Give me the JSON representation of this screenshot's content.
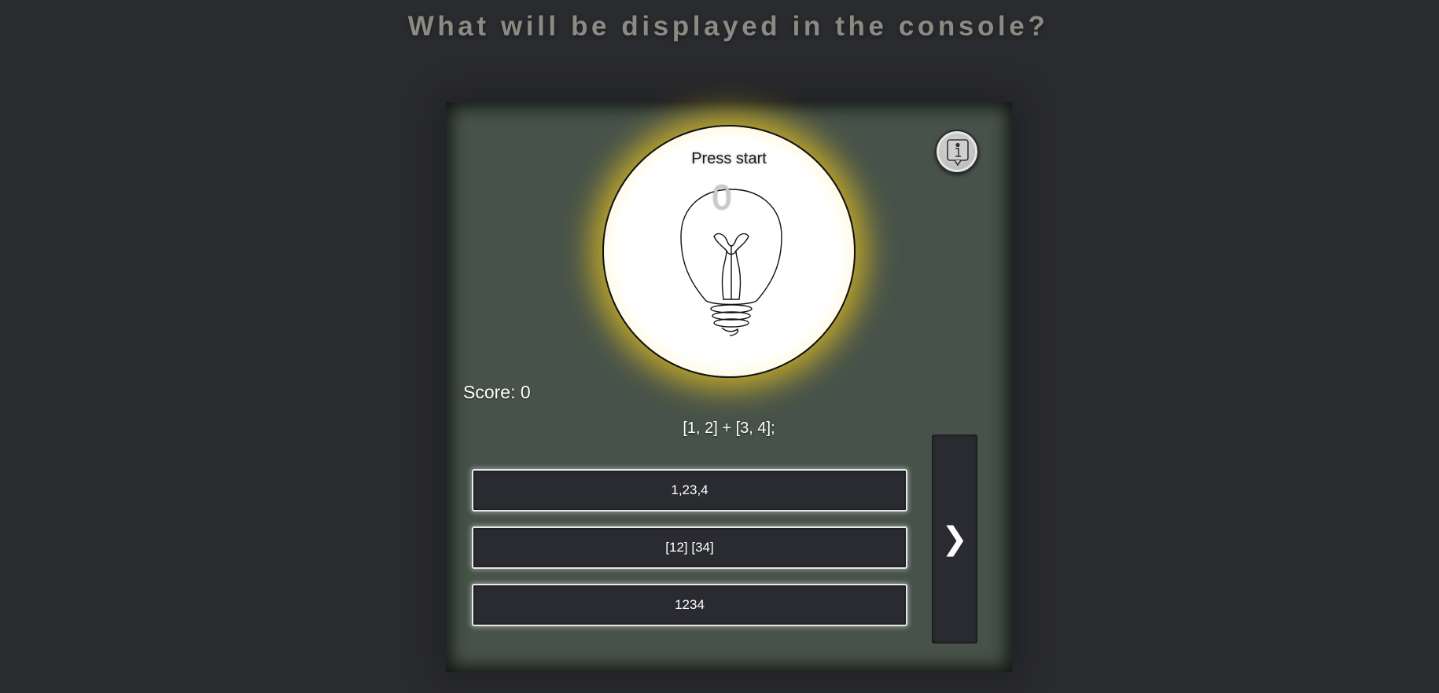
{
  "header": {
    "title": "What will be displayed in the console?"
  },
  "quiz": {
    "status_text": "Press start",
    "timer_value": "0",
    "score_text": "Score: 0",
    "question_code": "[1, 2] + [3, 4];",
    "answers": [
      {
        "label": "1,23,4"
      },
      {
        "label": "[12] [34]"
      },
      {
        "label": "1234"
      }
    ],
    "next_button_glyph": "❯",
    "info_icon": "info-icon",
    "bulb_icon": "lightbulb-icon"
  },
  "colors": {
    "background": "#2a2b2f",
    "card": "#46524a",
    "glow": "#f0c81e",
    "button": "#2a2b30",
    "heading": "#8a8b82"
  }
}
